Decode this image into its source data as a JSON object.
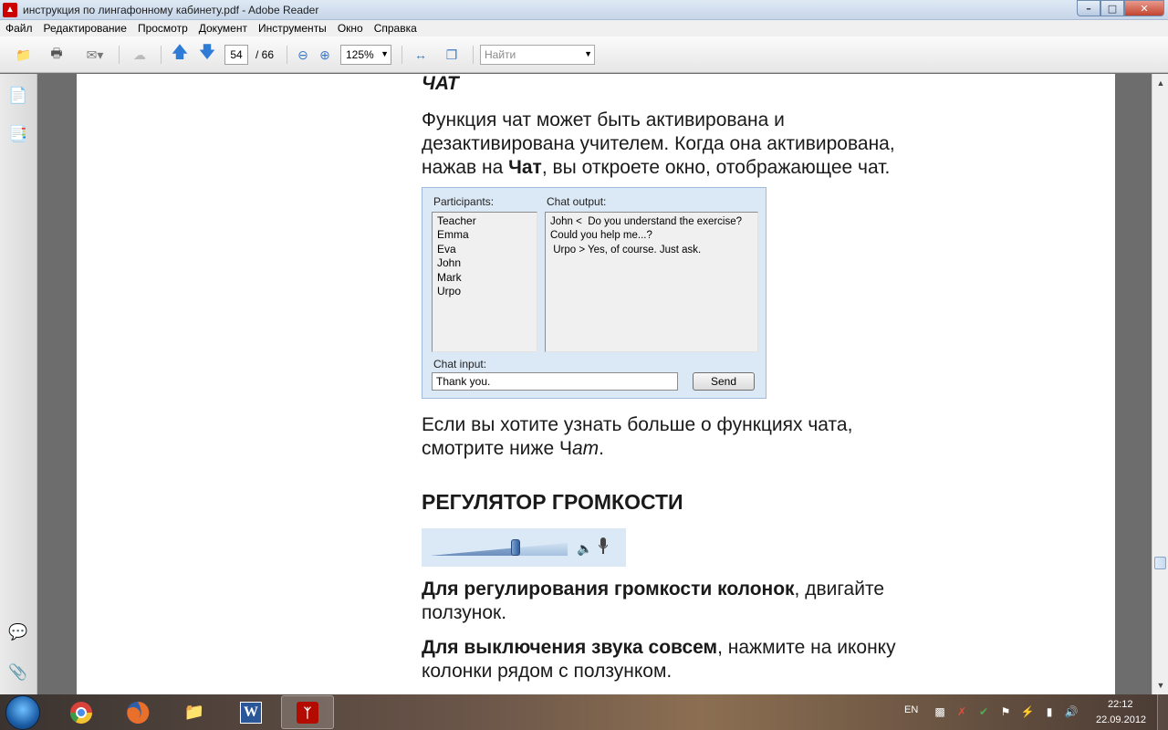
{
  "window": {
    "title": "инструкция по лингафонному кабинету.pdf - Adobe Reader",
    "app_icon": "pdf-icon"
  },
  "menu": [
    "Файл",
    "Редактирование",
    "Просмотр",
    "Документ",
    "Инструменты",
    "Окно",
    "Справка"
  ],
  "toolbar": {
    "page_current": "54",
    "page_total": "/ 66",
    "zoom": "125%",
    "find_placeholder": "Найти"
  },
  "document": {
    "heading_chat": "ЧАТ",
    "para1": "Функция чат может быть активирована и дезактивирована учителем. Когда она активирована, нажав на Чат, вы откроете окно, отображающее чат.",
    "para1_parts": [
      "Функция чат может быть активирована и",
      "дезактивирована учителем. Когда она активирована,",
      "нажав на ",
      "Чат",
      ", вы откроете окно, отображающее чат."
    ],
    "chat_figure": {
      "participants_label": "Participants:",
      "output_label": "Chat output:",
      "input_label": "Chat input:",
      "participants": [
        "Teacher",
        "Emma",
        "Eva",
        "John",
        "Mark",
        "Urpo"
      ],
      "messages": [
        "John <  Do you understand the exercise?",
        "Could you help me...?",
        " Urpo > Yes, of course. Just ask."
      ],
      "input_value": "Thank you.",
      "send_label": "Send"
    },
    "para2_parts": [
      "Если вы хотите узнать больше о функциях чата,",
      "смотрите ниже Ч",
      "ат",
      "."
    ],
    "heading_volume": "РЕГУЛЯТОР ГРОМКОСТИ",
    "volume_level": 0.62,
    "para3_bold": "Для регулирования громкости колонок",
    "para3_rest": ", двигайте",
    "para3_line2": "ползунок.",
    "para4_bold": "Для выключения звука совсем",
    "para4_rest": ", нажмите на иконку",
    "para4_line2": "колонки рядом с ползунком."
  },
  "taskbar": {
    "language": "EN",
    "time": "22:12",
    "date": "22.09.2012"
  }
}
